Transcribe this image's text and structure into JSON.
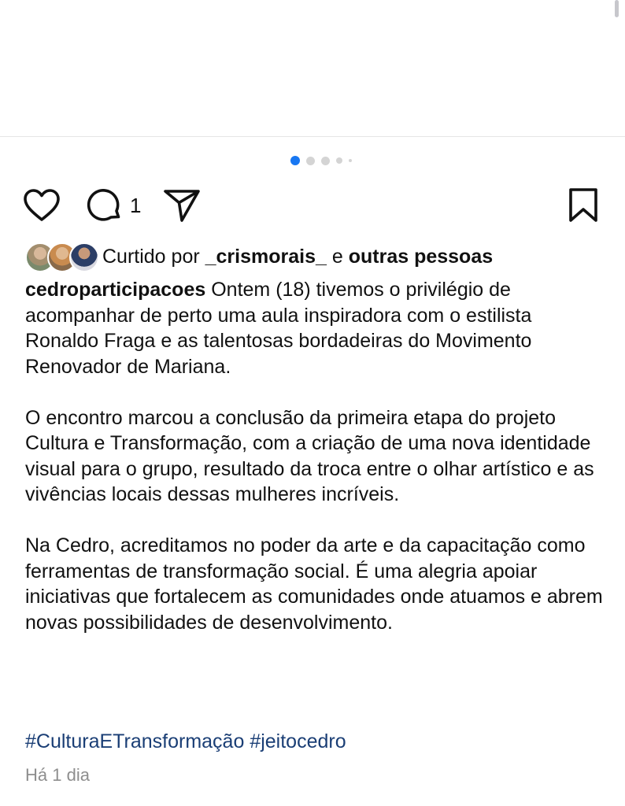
{
  "post": {
    "comment_count": "1",
    "liked_by_prefix": "Curtido por",
    "liked_by_user": "_crismorais_",
    "liked_by_connector": "e",
    "liked_by_others": "outras pessoas",
    "username": "cedroparticipacoes",
    "caption_p1": "Ontem (18) tivemos o privilégio de acompanhar de perto uma aula inspiradora com o estilista Ronaldo Fraga e as talentosas bordadeiras do Movimento Renovador de Mariana.",
    "caption_p2": "O encontro marcou a conclusão da primeira etapa do projeto Cultura e Transformação, com a criação de uma nova identidade visual para o grupo, resultado da troca entre o olhar artístico e as vivências locais dessas mulheres incríveis.",
    "caption_p3": "Na Cedro, acreditamos no poder da arte e da capacitação como ferramentas de transformação social. É uma alegria apoiar iniciativas que fortalecem as comunidades onde atuamos e abrem novas possibilidades de desenvolvimento.",
    "hashtags": [
      "#CulturaETransformação",
      "#jeitocedro"
    ],
    "timestamp": "Há 1 dia"
  },
  "carousel": {
    "count": 5,
    "active_index": 0,
    "active_color": "#1877f2",
    "inactive_color": "#d4d4d4"
  },
  "icons": {
    "like": "heart-outline-icon",
    "comment": "speech-bubble-icon",
    "share": "paper-plane-icon",
    "save": "bookmark-icon"
  },
  "colors": {
    "hashtag": "#1a3e75",
    "secondary_text": "#8e8e8e",
    "text": "#111111"
  }
}
